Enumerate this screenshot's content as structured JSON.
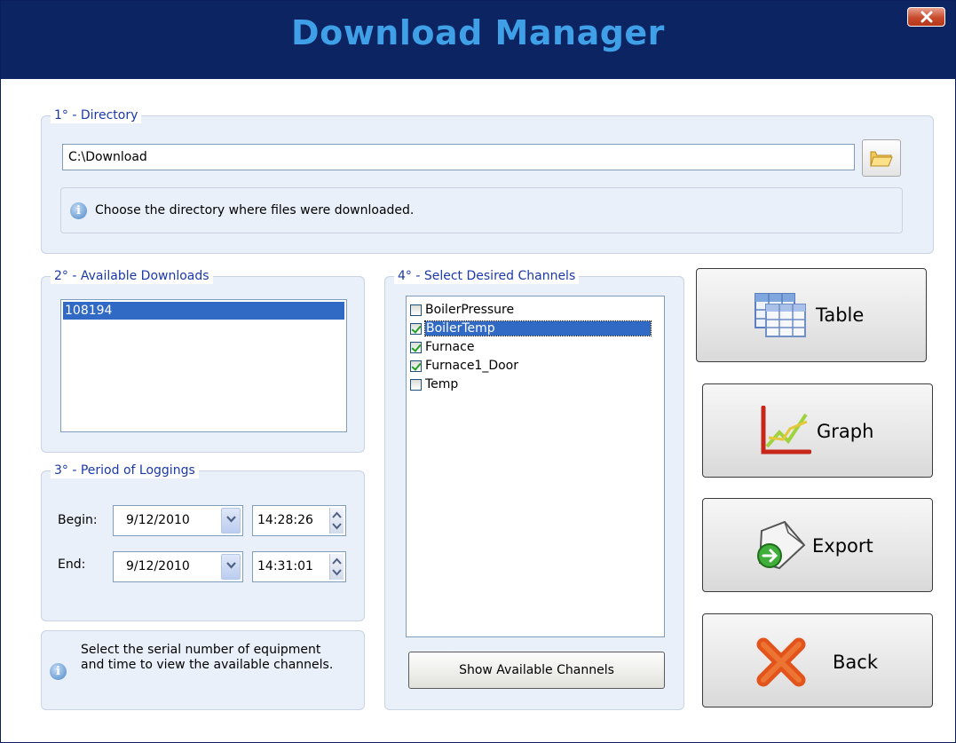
{
  "window": {
    "title": "Download Manager",
    "accent_color": "#3fa0e8",
    "titlebar_color": "#0c2462"
  },
  "directory_group": {
    "legend": "1° - Directory",
    "path_value": "C:\\Download",
    "browse_icon": "folder-open-icon",
    "info_text": "Choose the directory where files were downloaded."
  },
  "downloads_group": {
    "legend": "2° - Available Downloads",
    "items": [
      "108194"
    ],
    "selected_index": 0
  },
  "period_group": {
    "legend": "3° - Period of Loggings",
    "begin_label": "Begin:",
    "begin_date": "9/12/2010",
    "begin_time": "14:28:26",
    "end_label": "End:",
    "end_date": "9/12/2010",
    "end_time": "14:31:01"
  },
  "hint": {
    "text": "Select the serial number of equipment and time to view the available channels."
  },
  "channels_group": {
    "legend": "4° - Select Desired Channels",
    "channels": [
      {
        "label": "BoilerPressure",
        "checked": false,
        "selected": false
      },
      {
        "label": "BoilerTemp",
        "checked": true,
        "selected": true
      },
      {
        "label": "Furnace",
        "checked": true,
        "selected": false
      },
      {
        "label": "Furnace1_Door",
        "checked": true,
        "selected": false
      },
      {
        "label": "Temp",
        "checked": false,
        "selected": false
      }
    ],
    "show_button_label": "Show Available Channels"
  },
  "actions": {
    "table_label": "Table",
    "graph_label": "Graph",
    "export_label": "Export",
    "back_label": "Back"
  }
}
